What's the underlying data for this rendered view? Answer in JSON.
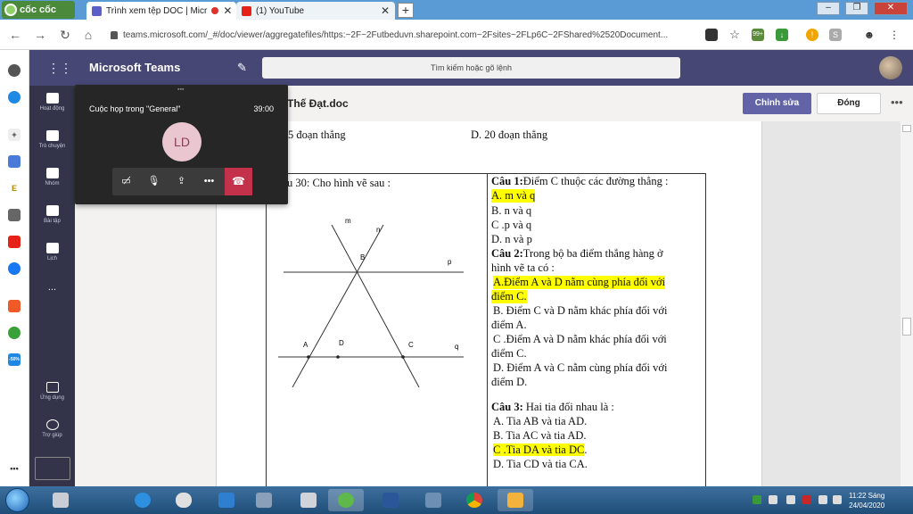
{
  "browser": {
    "brand": "cốc cốc",
    "tabs": [
      {
        "title": "Trình xem tệp DOC | Micr",
        "active": true,
        "recording": true
      },
      {
        "title": "(1) YouTube",
        "active": false
      }
    ],
    "url": "teams.microsoft.com/_#/doc/viewer/aggregatefiles/https:~2F~2Futbeduvn.sharepoint.com~2Fsites~2FLp6C~2FShared%2520Document...",
    "extension_badge": "99+"
  },
  "teams": {
    "app_title": "Microsoft Teams",
    "search_placeholder": "Tìm kiếm hoặc gõ lệnh",
    "nav": [
      {
        "label": "Hoạt động"
      },
      {
        "label": "Trò chuyện"
      },
      {
        "label": "Nhóm"
      },
      {
        "label": "Bài tập"
      },
      {
        "label": "Lịch"
      },
      {
        "label": "..."
      },
      {
        "label": "Ứng dụng"
      },
      {
        "label": "Trợ giúp"
      }
    ]
  },
  "doc": {
    "title": "Thế Đạt.doc",
    "edit_label": "Chỉnh sửa",
    "close_label": "Đóng",
    "line_top_left": "5 đoạn thẳng",
    "line_top_right": "D. 20 đoạn thẳng",
    "question_label": "u 30: Cho hình vẽ sau :",
    "figure_labels": {
      "m": "m",
      "n": "n",
      "p": "p",
      "q": "q",
      "A": "A",
      "B": "B",
      "C": "C",
      "D": "D"
    },
    "q1": {
      "title_bold": "Câu 1:",
      "title_rest": "Điểm C thuộc các đường thẳng :",
      "options": [
        "A. m và q",
        "B. n và q",
        "C .p và q",
        "D. n và p"
      ]
    },
    "q2": {
      "title_bold": "Câu 2:",
      "title_rest": "Trong bộ ba điểm thẳng hàng ở",
      "title_line2": "hình vẽ ta có :",
      "options": [
        [
          "A.Điểm A và D nằm cùng phía đối với",
          "điểm C."
        ],
        [
          "B. Điểm C và D nằm khác phía đối với",
          "điểm A."
        ],
        [
          "C .Điểm A và D nằm khác phía đối với",
          "điểm C."
        ],
        [
          "D. Điểm A và C nằm cùng phía đối với",
          "điểm D."
        ]
      ]
    },
    "q3": {
      "title_bold": "Câu 3:",
      "title_rest": " Hai tia đối nhau là :",
      "options": [
        "A. Tia AB và tia AD.",
        "B. Tia AC và tia AD.",
        "C .Tia DA và tia DC",
        "D. Tia CD và tia CA."
      ],
      "option3_suffix": "."
    },
    "highlight_color": "#ffff00"
  },
  "call": {
    "title": "Cuộc họp trong \"General\"",
    "time": "39:00",
    "initials": "LD"
  },
  "taskbar": {
    "time": "11:22 Sáng",
    "date": "24/04/2020"
  }
}
